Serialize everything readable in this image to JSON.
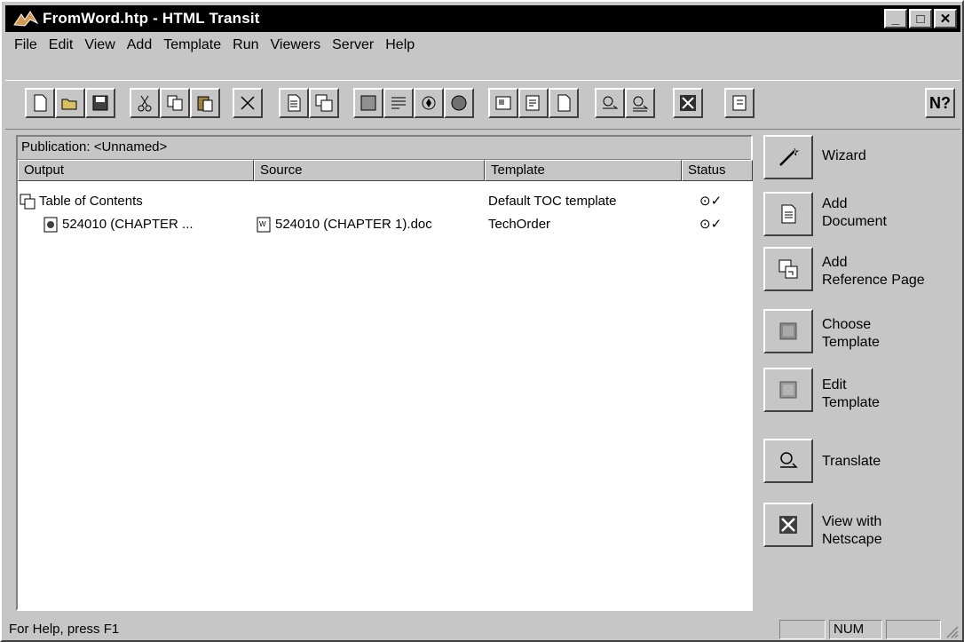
{
  "window": {
    "title": "FromWord.htp - HTML Transit",
    "controls": {
      "minimize": "_",
      "maximize": "□",
      "close": "✕"
    }
  },
  "menu": [
    "File",
    "Edit",
    "View",
    "Add",
    "Template",
    "Run",
    "Viewers",
    "Server",
    "Help"
  ],
  "toolbar": {
    "help_label": "N?",
    "icons": [
      "new-icon",
      "open-icon",
      "save-icon",
      "cut-icon",
      "copy-icon",
      "paste-icon",
      "delete-icon",
      "add-document-icon",
      "add-reference-icon",
      "template-icon",
      "edit-icon",
      "navigation-icon",
      "globe-icon",
      "options-icon",
      "properties-icon",
      "page-icon",
      "translate-icon",
      "translate-all-icon",
      "netscape-icon",
      "server-icon",
      "context-help-icon"
    ]
  },
  "publication": {
    "label": "Publication: <Unnamed>"
  },
  "columns": {
    "output": "Output",
    "source": "Source",
    "template": "Template",
    "status": "Status"
  },
  "rows": [
    {
      "output": "Table of Contents",
      "source": "",
      "template": "Default TOC template",
      "status": "⊙✓"
    },
    {
      "output": "524010 (CHAPTER ...",
      "source": "524010 (CHAPTER 1).doc",
      "template": "TechOrder",
      "status": "⊙✓"
    }
  ],
  "side_buttons": [
    {
      "label1": "Wizard",
      "label2": "",
      "icon": "wizard-wand-icon"
    },
    {
      "label1": "Add",
      "label2": "Document",
      "icon": "add-document-icon"
    },
    {
      "label1": "Add",
      "label2": "Reference Page",
      "icon": "add-reference-page-icon"
    },
    {
      "label1": "Choose",
      "label2": "Template",
      "icon": "choose-template-icon"
    },
    {
      "label1": "Edit",
      "label2": "Template",
      "icon": "edit-template-icon"
    },
    {
      "label1": "Translate",
      "label2": "",
      "icon": "translate-icon"
    },
    {
      "label1": "View with",
      "label2": "Netscape",
      "icon": "netscape-icon"
    }
  ],
  "status": {
    "text": "For Help, press F1",
    "num": "NUM"
  },
  "colors": {
    "title_bg": "#000000",
    "face": "#c6c6c6",
    "list_bg": "#ffffff"
  }
}
